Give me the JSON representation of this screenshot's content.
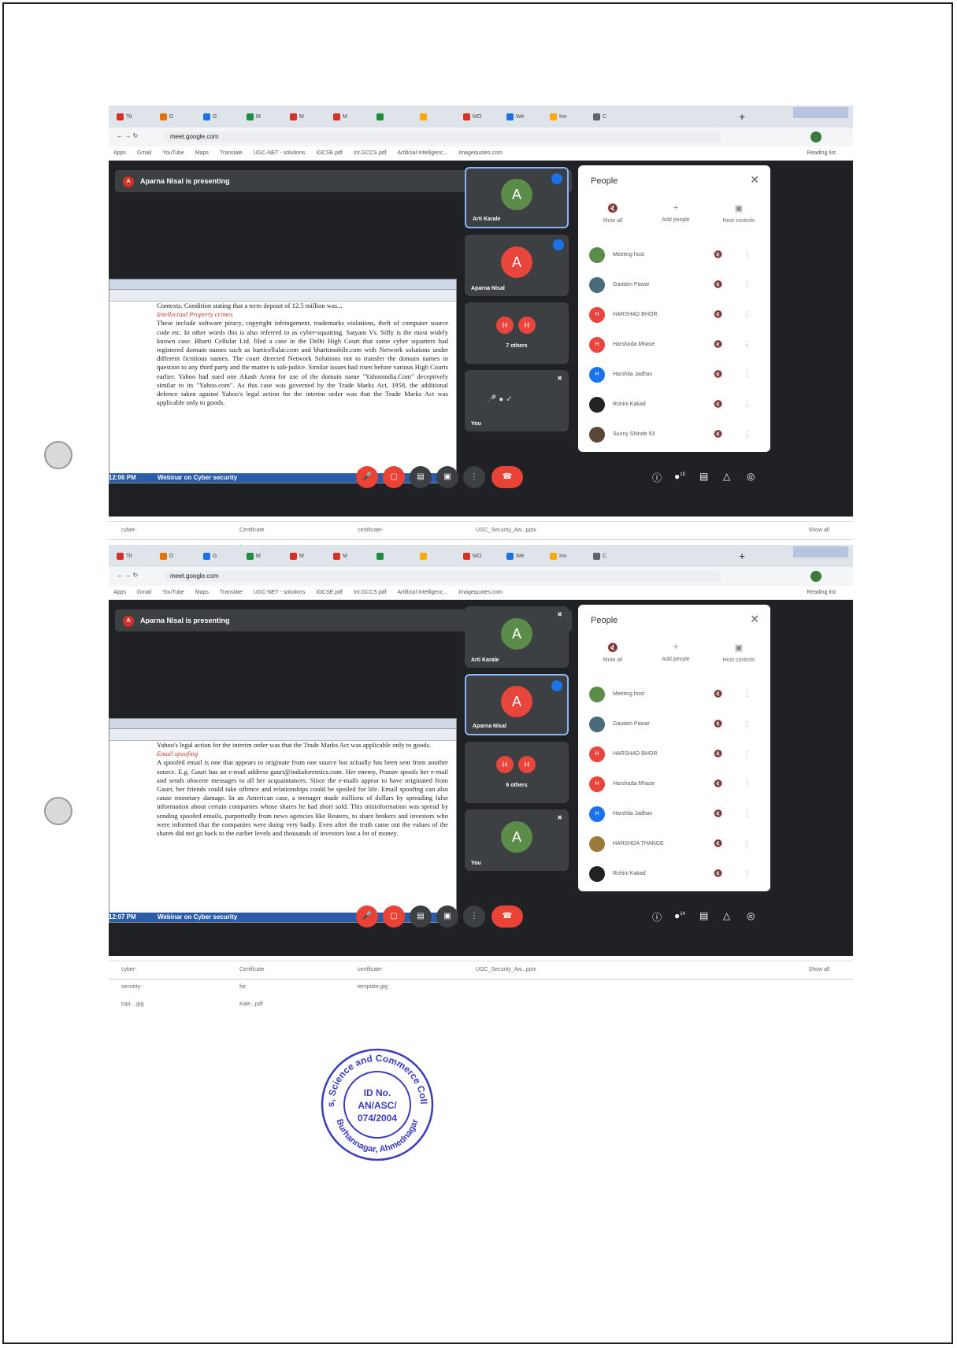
{
  "screenshots": [
    {
      "tabs": [
        "Tit",
        "D",
        "G",
        "M",
        "M",
        "M",
        "",
        "",
        "MO",
        "We",
        "Inv",
        "C"
      ],
      "url": "meet.google.com",
      "bookmarks": [
        "Apps",
        "Gmail",
        "YouTube",
        "Maps",
        "Translate",
        "UGC-NET - solutions",
        "IGCSE.pdf",
        "Int.GCCS.pdf",
        "Artificial Intelligenc...",
        "Imagequotes.com"
      ],
      "reading_list": "Reading list",
      "presenting": "Aparna Nisal is presenting",
      "doc_heading_top": "Contexts. Condition stating that a term deposit of 12.5 million was...",
      "doc_section": "Intellectual Property crimes",
      "doc_text": "These include software piracy, copyright infringement, trademarks violations, theft of computer source code etc. In other words this is also referred to as cyber-squatting. Satyam Vs. Siffy is the most widely known case. Bharti Cellular Ltd. filed a case in the Delhi High Court that some cyber squatters had registered domain names such as barticellular.com and bhartimobile.com with Network solutions under different fictitious names. The court directed Network Solutions not to transfer the domain names in question to any third party and the matter is sub-judice. Similar issues had risen before various High Courts earlier. Yahoo had sued one Akash Arora for use of the domain name \"Yahooindia.Com\" deceptively similar to its \"Yahoo.com\". As this case was governed by the Trade Marks Act, 1958, the additional defence taken against Yahoo's legal action for the interim order was that the Trade Marks Act was applicable only to goods.",
      "tiles": [
        {
          "initial": "A",
          "name": "Arti Karale",
          "color": "#5b8c4a",
          "active": true,
          "speaking": true
        },
        {
          "initial": "A",
          "name": "Aparna Nisal",
          "color": "#e8453c",
          "active": false,
          "speaking": true
        },
        {
          "pair": [
            "H",
            "H"
          ],
          "name": "7 others"
        },
        {
          "self": true,
          "name": "You"
        }
      ],
      "people_title": "People",
      "actions": [
        "Mute all",
        "Add people",
        "Host controls"
      ],
      "people": [
        {
          "name": "Meeting host",
          "initial": "",
          "color": "#5b8c4a"
        },
        {
          "name": "Gautam Pawar",
          "initial": "",
          "color": "#4a6b7a"
        },
        {
          "name": "HARSHAD BHOR",
          "initial": "H",
          "color": "#e8453c"
        },
        {
          "name": "Harshada Mhase",
          "initial": "H",
          "color": "#e8453c"
        },
        {
          "name": "Harshila Jadhav",
          "initial": "H",
          "color": "#1a73e8"
        },
        {
          "name": "Rohini Kakad",
          "initial": "",
          "color": "#222"
        },
        {
          "name": "Sunny Shinde 53",
          "initial": "",
          "color": "#5a4636"
        },
        {
          "name": "",
          "initial": "",
          "color": "#8a5a3a"
        }
      ],
      "time": "12:06 PM",
      "meeting": "Webinar on Cyber security",
      "participants_badge": "15",
      "downloads": [
        "cyber-security-topi....jpg",
        "Certificate for Kale...pdf",
        "certificate-template.jpg",
        "UGC_Security_Aw...pptx"
      ],
      "show_all": "Show all"
    },
    {
      "tabs": [
        "Tit",
        "D",
        "G",
        "M",
        "M",
        "M",
        "",
        "",
        "MO",
        "We",
        "Inv",
        "C"
      ],
      "url": "meet.google.com",
      "bookmarks": [
        "Apps",
        "Gmail",
        "YouTube",
        "Maps",
        "Translate",
        "UGC-NET - solutions",
        "IGCSE.pdf",
        "Int.GCCS.pdf",
        "Artificial Intelligenc...",
        "Imagequotes.com"
      ],
      "reading_list": "Reading list",
      "presenting": "Aparna Nisal is presenting",
      "doc_heading_top": "Yahoo's legal action for the interim order was that the Trade Marks Act was applicable only to goods.",
      "doc_section": "Email spoofing",
      "doc_text": "A spoofed email is one that appears to originate from one source but actually has been sent from another source. E.g. Gauri has an e-mail address gauri@indiaforensics.com. Her enemy, Pranav spoofs her e-mail and sends obscene messages to all her acquaintances. Since the e-mails appear to have originated from Gauri, her friends could take offence and relationships could be spoiled for life. Email spoofing can also cause monetary damage. In an American case, a teenager made millions of dollars by spreading false information about certain companies whose shares he had short sold. This misinformation was spread by sending spoofed emails, purportedly from news agencies like Reuters, to share brokers and investors who were informed that the companies were doing very badly. Even after the truth came out the values of the shares did not go back to the earlier levels and thousands of investors lost a lot of money.",
      "tiles": [
        {
          "initial": "A",
          "name": "Arti Karale",
          "color": "#5b8c4a",
          "active": false,
          "speaking": false
        },
        {
          "initial": "A",
          "name": "Aparna Nisal",
          "color": "#e8453c",
          "active": true,
          "speaking": true
        },
        {
          "pair": [
            "H",
            "H"
          ],
          "name": "6 others"
        },
        {
          "initial": "A",
          "name": "You",
          "color": "#5b8c4a",
          "active": false,
          "speaking": false
        }
      ],
      "people_title": "People",
      "actions": [
        "Mute all",
        "Add people",
        "Host controls"
      ],
      "people": [
        {
          "name": "Meeting host",
          "initial": "",
          "color": "#5b8c4a"
        },
        {
          "name": "Gautam Pawar",
          "initial": "",
          "color": "#4a6b7a"
        },
        {
          "name": "HARSHAD BHOR",
          "initial": "H",
          "color": "#e8453c"
        },
        {
          "name": "Harshada Mhase",
          "initial": "H",
          "color": "#e8453c"
        },
        {
          "name": "Harshila Jadhav",
          "initial": "H",
          "color": "#1a73e8"
        },
        {
          "name": "HARSHDA THANGE",
          "initial": "",
          "color": "#9a7a3a"
        },
        {
          "name": "Rohini Kakad",
          "initial": "",
          "color": "#222"
        },
        {
          "name": "",
          "initial": "",
          "color": "#5a4636"
        }
      ],
      "time": "12:07 PM",
      "meeting": "Webinar on Cyber security",
      "participants_badge": "14",
      "downloads": [
        "cyber-security-topi....jpg",
        "Certificate for Kale...pdf",
        "certificate-template.jpg",
        "UGC_Security_Aw...pptx"
      ],
      "show_all": "Show all"
    }
  ],
  "stamp": {
    "top_arc": "Arts, Science and Commerce College",
    "bottom_arc": "Burhannagar, Ahmednagar",
    "line1": "ID No.",
    "line2": "AN/ASC/",
    "line3": "074/2004",
    "color": "#3b3bbf"
  }
}
